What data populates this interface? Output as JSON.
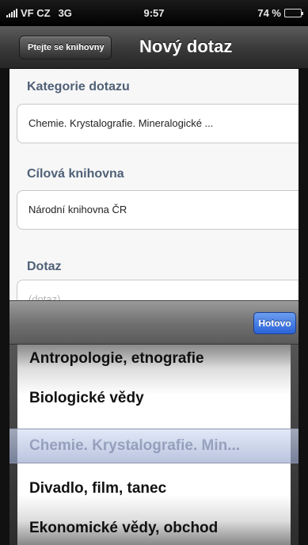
{
  "status_bar": {
    "carrier": "VF CZ",
    "network": "3G",
    "time": "9:57",
    "battery": "74 %",
    "battery_level": 0.74
  },
  "nav": {
    "back_label": "Ptejte se knihovny",
    "title": "Nový dotaz"
  },
  "form": {
    "category_label": "Kategorie dotazu",
    "category_value": "Chemie. Krystalografie. Mineralogické ...",
    "library_label": "Cílová knihovna",
    "library_value": "Národní knihovna ČR",
    "query_label": "Dotaz",
    "query_placeholder": "(dotaz)"
  },
  "toolbar": {
    "done_label": "Hotovo"
  },
  "picker": {
    "items": [
      "Antropologie, etnografie",
      "Biologické vědy",
      "Chemie. Krystalografie. Min...",
      "Divadlo, film, tanec",
      "Ekonomické vědy, obchod"
    ],
    "selected_index": 2
  },
  "colors": {
    "label": "#4f6077",
    "done_button": "#2a62d9",
    "nav_bar": "#3b3b3b"
  }
}
